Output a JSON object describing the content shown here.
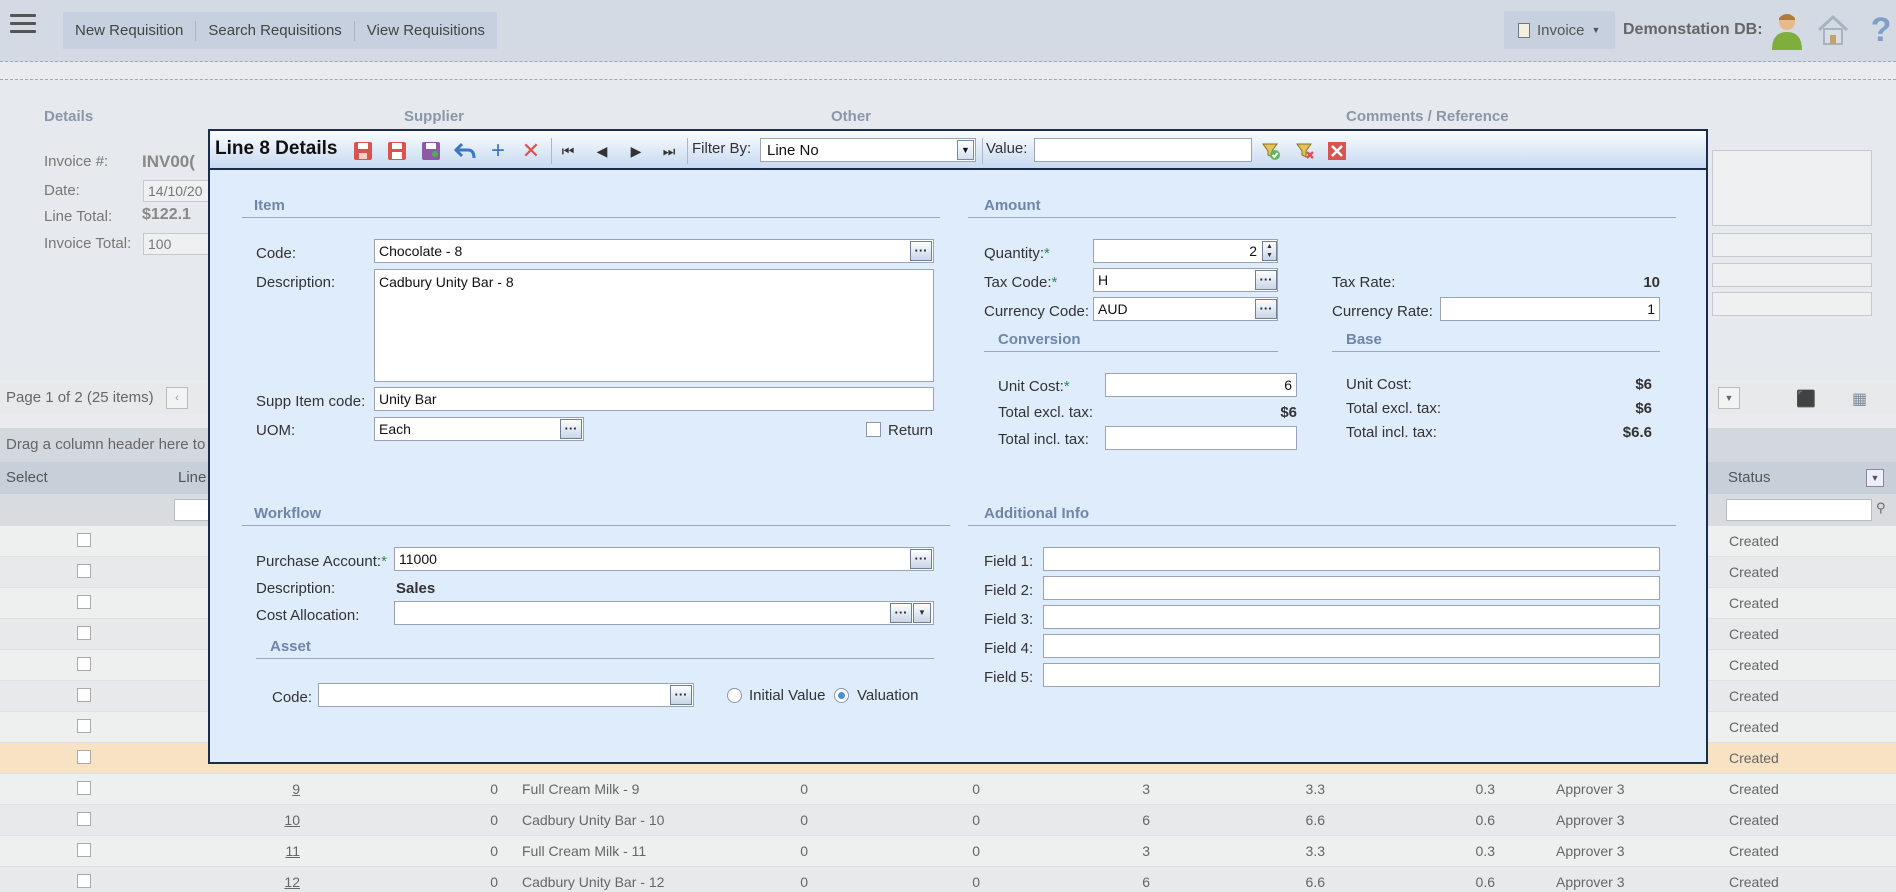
{
  "nav": {
    "items": [
      "New Requisition",
      "Search Requisitions",
      "View Requisitions"
    ],
    "invoice_dropdown": "Invoice",
    "db_label": "Demonstation DB:"
  },
  "bg": {
    "sections": [
      "Details",
      "Supplier",
      "Other",
      "Comments / Reference"
    ],
    "invoice_label": "Invoice #:",
    "invoice_value": "INV00(",
    "date_label": "Date:",
    "date_value": "14/10/20",
    "line_total_label": "Line Total:",
    "line_total_value": "$122.1",
    "invoice_total_label": "Invoice Total:",
    "invoice_total_value": "100"
  },
  "grid": {
    "pager_text": "Page 1 of 2 (25 items)",
    "drag_hint": "Drag a column header here to",
    "col_select": "Select",
    "col_line": "Line",
    "col_status": "Status",
    "status_value": "Created",
    "rows": [
      {
        "line": "9",
        "qty": "0",
        "desc": "Full Cream Milk - 9",
        "a": "0",
        "b": "0",
        "c": "3",
        "d": "3.3",
        "e": "0.3",
        "approver": "Approver 3"
      },
      {
        "line": "10",
        "qty": "0",
        "desc": "Cadbury Unity Bar - 10",
        "a": "0",
        "b": "0",
        "c": "6",
        "d": "6.6",
        "e": "0.6",
        "approver": "Approver 3"
      },
      {
        "line": "11",
        "qty": "0",
        "desc": "Full Cream Milk - 11",
        "a": "0",
        "b": "0",
        "c": "3",
        "d": "3.3",
        "e": "0.3",
        "approver": "Approver 3"
      },
      {
        "line": "12",
        "qty": "0",
        "desc": "Cadbury Unity Bar - 12",
        "a": "0",
        "b": "0",
        "c": "6",
        "d": "6.6",
        "e": "0.6",
        "approver": "Approver 3"
      }
    ]
  },
  "modal": {
    "title": "Line 8 Details",
    "filter_by_label": "Filter By:",
    "filter_by_value": "Line No",
    "value_label": "Value:",
    "value_value": "",
    "item": {
      "section": "Item",
      "code_label": "Code:",
      "code_value": "Chocolate - 8",
      "description_label": "Description:",
      "description_value": "Cadbury Unity Bar - 8",
      "supp_item_label": "Supp Item code:",
      "supp_item_value": "Unity Bar",
      "uom_label": "UOM:",
      "uom_value": "Each",
      "return_label": "Return"
    },
    "amount": {
      "section": "Amount",
      "quantity_label": "Quantity:",
      "quantity_value": "2",
      "tax_code_label": "Tax Code:",
      "tax_code_value": "H",
      "currency_code_label": "Currency Code:",
      "currency_code_value": "AUD",
      "tax_rate_label": "Tax Rate:",
      "tax_rate_value": "10",
      "currency_rate_label": "Currency Rate:",
      "currency_rate_value": "1",
      "conversion_section": "Conversion",
      "base_section": "Base",
      "conv_unit_cost_label": "Unit Cost:",
      "conv_unit_cost_value": "6",
      "conv_excl_label": "Total excl. tax:",
      "conv_excl_value": "$6",
      "conv_incl_label": "Total incl. tax:",
      "conv_incl_value": "",
      "base_unit_cost_label": "Unit Cost:",
      "base_unit_cost_value": "$6",
      "base_excl_label": "Total excl. tax:",
      "base_excl_value": "$6",
      "base_incl_label": "Total incl. tax:",
      "base_incl_value": "$6.6"
    },
    "workflow": {
      "section": "Workflow",
      "purchase_account_label": "Purchase Account:",
      "purchase_account_value": "11000",
      "description_label": "Description:",
      "description_value": "Sales",
      "cost_allocation_label": "Cost Allocation:",
      "cost_allocation_value": "",
      "asset_section": "Asset",
      "asset_code_label": "Code:",
      "asset_code_value": "",
      "initial_value_label": "Initial Value",
      "valuation_label": "Valuation",
      "selected_radio": "Valuation"
    },
    "additional": {
      "section": "Additional Info",
      "fields": [
        {
          "label": "Field 1:",
          "value": ""
        },
        {
          "label": "Field 2:",
          "value": ""
        },
        {
          "label": "Field 3:",
          "value": ""
        },
        {
          "label": "Field 4:",
          "value": ""
        },
        {
          "label": "Field 5:",
          "value": ""
        }
      ]
    }
  },
  "colors": {
    "modal_bg": "#dfecfb",
    "modal_border": "#1d2c4b",
    "section_title": "#6f86a8",
    "selected_row": "#f7e3c4"
  }
}
